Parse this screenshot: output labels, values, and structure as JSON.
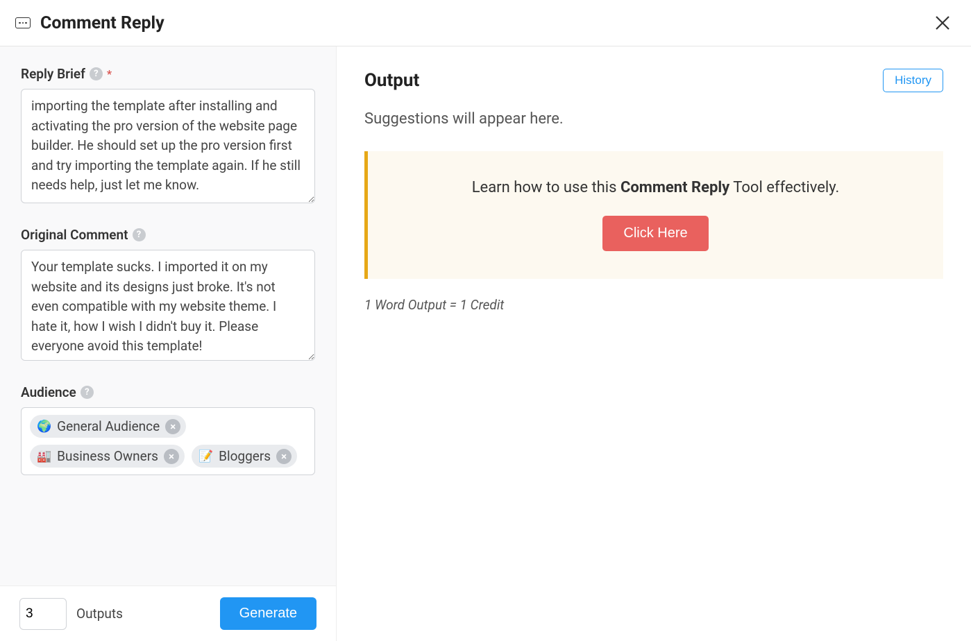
{
  "header": {
    "title": "Comment Reply"
  },
  "left": {
    "reply_brief": {
      "label": "Reply Brief",
      "value": "importing the template after installing and activating the pro version of the website page builder. He should set up the pro version first and try importing the template again. If he still needs help, just let me know."
    },
    "original_comment": {
      "label": "Original Comment",
      "value": "Your template sucks. I imported it on my website and its designs just broke. It's not even compatible with my website theme. I hate it, how I wish I didn't buy it. Please everyone avoid this template!"
    },
    "audience": {
      "label": "Audience",
      "tags": [
        {
          "emoji": "🌍",
          "label": "General Audience"
        },
        {
          "emoji": "🏭",
          "label": "Business Owners"
        },
        {
          "emoji": "📝",
          "label": "Bloggers"
        }
      ]
    },
    "footer": {
      "outputs_value": "3",
      "outputs_label": "Outputs",
      "generate_label": "Generate"
    }
  },
  "right": {
    "heading": "Output",
    "history_label": "History",
    "placeholder": "Suggestions will appear here.",
    "info_prefix": "Learn how to use this ",
    "info_bold": "Comment Reply",
    "info_suffix": " Tool effectively.",
    "click_here_label": "Click Here",
    "credit_text": "1 Word Output = 1 Credit"
  }
}
